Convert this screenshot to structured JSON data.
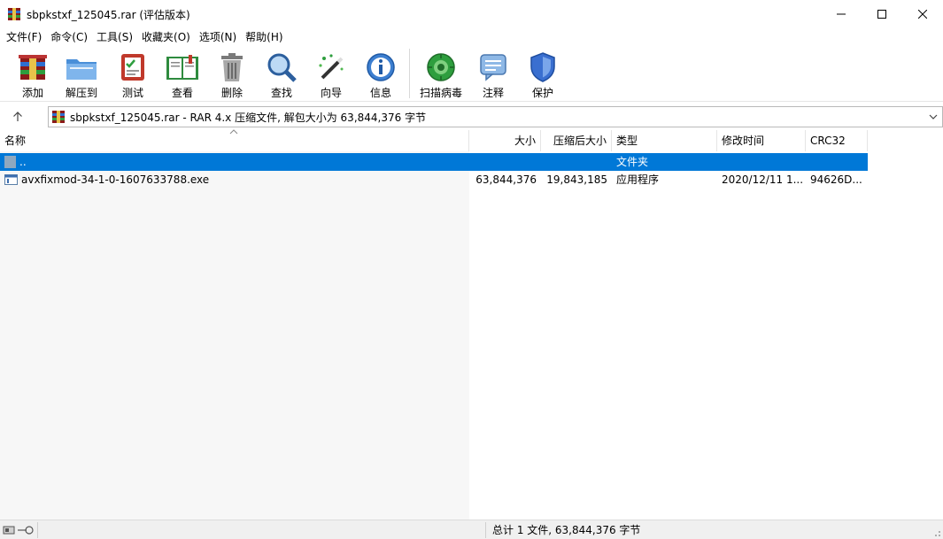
{
  "window": {
    "title": "sbpkstxf_125045.rar (评估版本)",
    "controls": {
      "minimize": "—",
      "maximize": "☐",
      "close": "✕"
    }
  },
  "menu": [
    "文件(F)",
    "命令(C)",
    "工具(S)",
    "收藏夹(O)",
    "选项(N)",
    "帮助(H)"
  ],
  "toolbar": {
    "add": "添加",
    "extract": "解压到",
    "test": "测试",
    "view": "查看",
    "delete": "删除",
    "find": "查找",
    "wizard": "向导",
    "info": "信息",
    "scan": "扫描病毒",
    "comment": "注释",
    "protect": "保护"
  },
  "address": {
    "text": "sbpkstxf_125045.rar - RAR 4.x 压缩文件, 解包大小为 63,844,376 字节"
  },
  "columns": {
    "name": "名称",
    "size": "大小",
    "packed": "压缩后大小",
    "type": "类型",
    "modified": "修改时间",
    "crc": "CRC32"
  },
  "rows": [
    {
      "name": "..",
      "size": "",
      "packed": "",
      "type": "文件夹",
      "modified": "",
      "crc": "",
      "selected": true
    },
    {
      "name": "avxfixmod-34-1-0-1607633788.exe",
      "size": "63,844,376",
      "packed": "19,843,185",
      "type": "应用程序",
      "modified": "2020/12/11 1...",
      "crc": "94626D...",
      "selected": false
    }
  ],
  "status": {
    "summary": "总计 1 文件, 63,844,376 字节"
  },
  "colors": {
    "selection": "#0078d7"
  }
}
